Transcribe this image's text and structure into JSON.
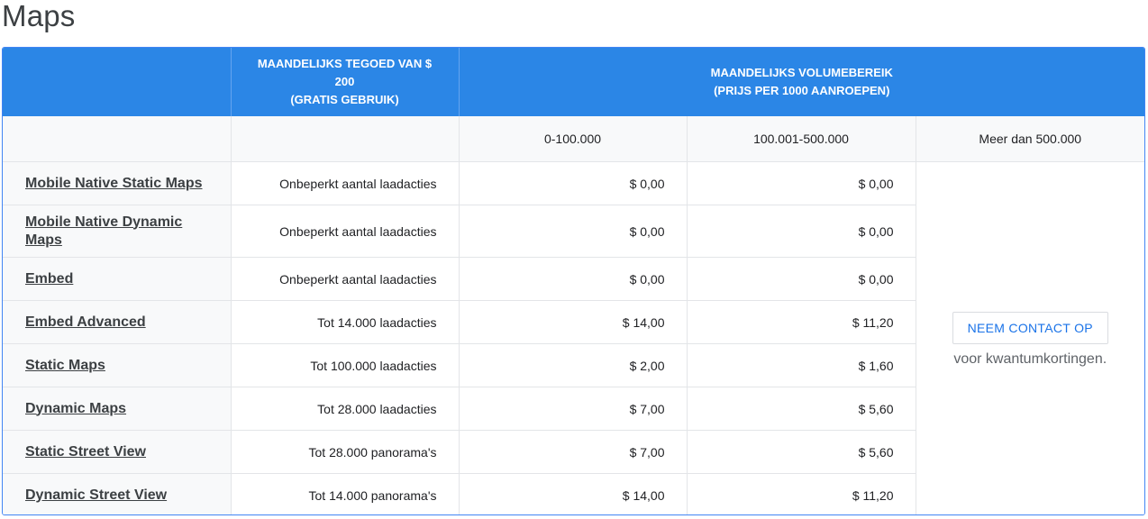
{
  "page": {
    "title": "Maps"
  },
  "header": {
    "col_credit_line1": "MAANDELIJKS TEGOED VAN $ 200",
    "col_credit_line2": "(GRATIS GEBRUIK)",
    "col_volume_line1": "MAANDELIJKS VOLUMEBEREIK",
    "col_volume_line2": "(PRIJS PER 1000 AANROEPEN)"
  },
  "tiers": [
    "0-100.000",
    "100.001-500.000",
    "Meer dan 500.000"
  ],
  "products": [
    {
      "name": "Mobile Native Static Maps",
      "credit": "Onbeperkt aantal laadacties",
      "tier1": "$ 0,00",
      "tier2": "$ 0,00"
    },
    {
      "name": "Mobile Native Dynamic Maps",
      "credit": "Onbeperkt aantal laadacties",
      "tier1": "$ 0,00",
      "tier2": "$ 0,00"
    },
    {
      "name": "Embed",
      "credit": "Onbeperkt aantal laadacties",
      "tier1": "$ 0,00",
      "tier2": "$ 0,00"
    },
    {
      "name": "Embed Advanced",
      "credit": "Tot 14.000 laadacties",
      "tier1": "$ 14,00",
      "tier2": "$ 11,20"
    },
    {
      "name": "Static Maps",
      "credit": "Tot 100.000 laadacties",
      "tier1": "$ 2,00",
      "tier2": "$ 1,60"
    },
    {
      "name": "Dynamic Maps",
      "credit": "Tot 28.000 laadacties",
      "tier1": "$ 7,00",
      "tier2": "$ 5,60"
    },
    {
      "name": "Static Street View",
      "credit": "Tot 28.000 panorama's",
      "tier1": "$ 7,00",
      "tier2": "$ 5,60"
    },
    {
      "name": "Dynamic Street View",
      "credit": "Tot 14.000 panorama's",
      "tier1": "$ 14,00",
      "tier2": "$ 11,20"
    }
  ],
  "contact": {
    "button_label": "NEEM CONTACT OP",
    "note": "voor kwantumkortingen."
  },
  "colors": {
    "header_bg": "#2b86e6",
    "accent_link": "#1a73e8",
    "row_label_bg": "#f8f9fa"
  }
}
